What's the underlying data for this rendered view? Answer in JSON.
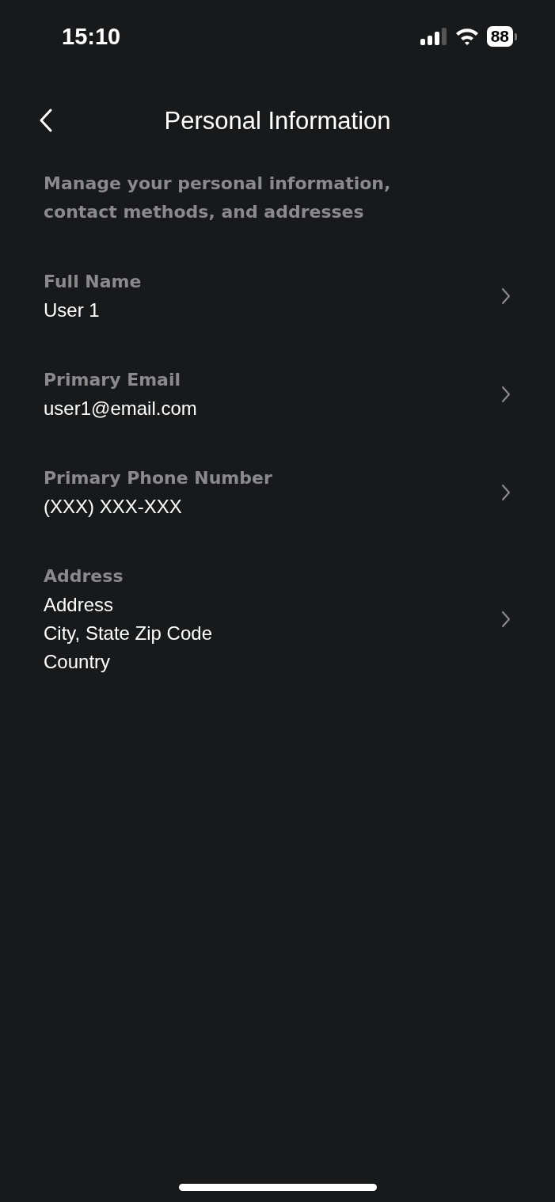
{
  "status_bar": {
    "time": "15:10",
    "battery": "88"
  },
  "header": {
    "title": "Personal Information"
  },
  "description": "Manage your personal information, contact methods, and addresses",
  "fields": [
    {
      "label": "Full Name",
      "lines": [
        "User 1"
      ]
    },
    {
      "label": "Primary Email",
      "lines": [
        "user1@email.com"
      ]
    },
    {
      "label": "Primary Phone Number",
      "lines": [
        "(XXX) XXX-XXX"
      ]
    },
    {
      "label": "Address",
      "lines": [
        "Address",
        "City, State Zip Code",
        "Country"
      ]
    }
  ]
}
